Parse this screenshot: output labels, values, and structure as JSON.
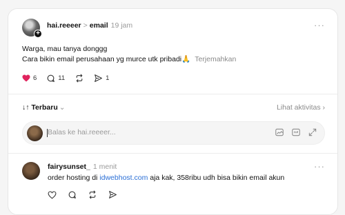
{
  "post": {
    "username": "hai.reeeer",
    "separator": ">",
    "topic": "email",
    "time": "19 jam",
    "more": "···",
    "line1": "Warga, mau tanya donggg",
    "line2": "Cara bikin email perusahaan yg murce utk pribadi🙏",
    "translate_label": "Terjemahkan",
    "likes": "6",
    "comments": "11",
    "shares": "1",
    "like_color": "#e0245e"
  },
  "sort": {
    "label": "↓↑ Terbaru",
    "chevron": "⌄",
    "activity_label": "Lihat aktivitas ›"
  },
  "reply": {
    "placeholder": "Balas ke hai.reeeer..."
  },
  "comment": {
    "username": "fairysunset_",
    "time": "1 menit",
    "more": "···",
    "text_before": "order hosting di ",
    "link": "idwebhost.com",
    "text_after": " aja kak, 358ribu udh bisa bikin email akun",
    "link_color": "#2a6fd6"
  }
}
